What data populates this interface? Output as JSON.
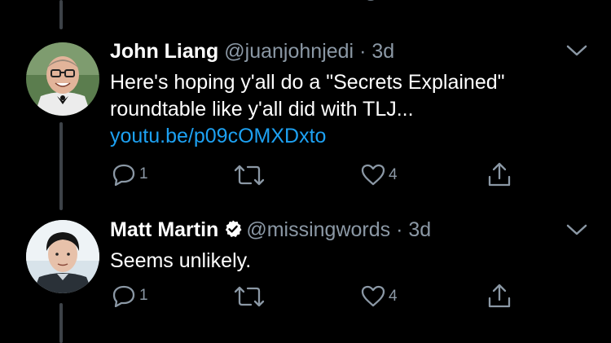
{
  "tweets": [
    {
      "name": "John Liang",
      "handle": "@juanjohnjedi",
      "separator": "·",
      "time": "3d",
      "verified": false,
      "text_lines": [
        "Here's hoping y'all do a \"Secrets Explained\"",
        "roundtable like y'all did with TLJ..."
      ],
      "link": "youtu.be/p09cOMXDxto",
      "replies": "1",
      "retweets": "",
      "likes": "4"
    },
    {
      "name": "Matt Martin",
      "handle": "@missingwords",
      "separator": "·",
      "time": "3d",
      "verified": true,
      "text_lines": [
        "Seems unlikely."
      ],
      "replies": "1",
      "retweets": "",
      "likes": "4"
    }
  ],
  "colors": {
    "background": "#000000",
    "text_primary": "#ffffff",
    "text_secondary": "#8b98a5",
    "link": "#1da1f2",
    "thread_line": "#3d4248"
  },
  "icons": [
    "reply-icon",
    "retweet-icon",
    "like-icon",
    "share-icon",
    "chevron-down-icon",
    "verified-badge-icon"
  ]
}
